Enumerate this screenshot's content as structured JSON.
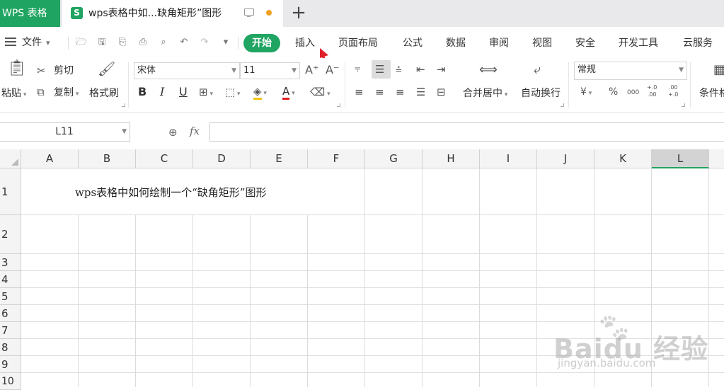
{
  "titlebar": {
    "app_tab": "WPS 表格",
    "doc_tab_icon": "S",
    "doc_tab_title": "wps表格中如...缺角矩形”图形",
    "new_tab": "+"
  },
  "menu": {
    "file": "文件",
    "tabs": [
      "开始",
      "插入",
      "页面布局",
      "公式",
      "数据",
      "审阅",
      "视图",
      "安全",
      "开发工具",
      "云服务"
    ],
    "active_tab": "开始"
  },
  "ribbon": {
    "paste": "粘贴",
    "cut": "剪切",
    "copy": "复制",
    "format_painter": "格式刷",
    "font_name": "宋体",
    "font_size": "11",
    "grow_font": "A⁺",
    "shrink_font": "A⁻",
    "bold": "B",
    "italic": "I",
    "underline": "U",
    "merge_center": "合并居中",
    "wrap_text": "自动换行",
    "number_format": "常规",
    "currency": "¥",
    "percent": "%",
    "thousands": "000",
    "inc_decimal": "+.0\n.00",
    "dec_decimal": ".00\n+.0",
    "conditional_format": "条件格"
  },
  "formula_bar": {
    "name_box": "L11",
    "fx": "fx",
    "formula": ""
  },
  "sheet": {
    "columns": [
      "A",
      "B",
      "C",
      "D",
      "E",
      "F",
      "G",
      "H",
      "I",
      "J",
      "K",
      "L"
    ],
    "selected_column": "L",
    "rows": [
      "1",
      "2",
      "3",
      "4",
      "5",
      "6",
      "7",
      "8",
      "9",
      "10"
    ],
    "cells": {
      "A1": "wps表格中如何绘制一个“缺角矩形”图形"
    }
  },
  "watermark": {
    "brand": "Baidu 经验",
    "url": "jingyan.baidu.com"
  },
  "colors": {
    "accent": "#1fa461",
    "annotation_arrow": "#e0202a",
    "modified_dot": "#f0a020"
  }
}
